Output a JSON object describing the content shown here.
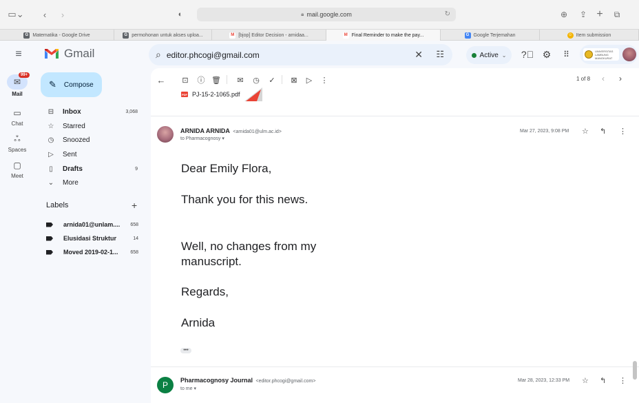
{
  "browser": {
    "url": "mail.google.com",
    "tabs": [
      {
        "label": "Matematika - Google Drive",
        "favicon_color": "#5f6368",
        "favicon": "G",
        "active": false
      },
      {
        "label": "permohonan untuk akses uploa...",
        "favicon_color": "#5f6368",
        "favicon": "G",
        "active": false
      },
      {
        "label": "[bjop] Editor Decision - arnidaa...",
        "favicon_color": "#ea4335",
        "favicon": "M",
        "active": false
      },
      {
        "label": "Final Reminder to make the pay...",
        "favicon_color": "#ea4335",
        "favicon": "M",
        "active": true
      },
      {
        "label": "Google Terjemahan",
        "favicon_color": "#4285f4",
        "favicon": "G",
        "active": false
      },
      {
        "label": "Item submission",
        "favicon_color": "#f4b400",
        "favicon": "☺",
        "active": false
      }
    ]
  },
  "header": {
    "app_name": "Gmail",
    "search_value": "editor.phcogi@gmail.com",
    "status_label": "Active",
    "status_color": "#188038",
    "university_text": "UNIVERSITAS LAMBUNG MANGKURAT"
  },
  "rail": {
    "items": [
      {
        "label": "Mail",
        "icon": "mail-icon",
        "badge": "99+",
        "active": true
      },
      {
        "label": "Chat",
        "icon": "chat-icon",
        "active": false
      },
      {
        "label": "Spaces",
        "icon": "spaces-icon",
        "active": false
      },
      {
        "label": "Meet",
        "icon": "meet-icon",
        "active": false
      }
    ]
  },
  "sidebar": {
    "compose_label": "Compose",
    "items": [
      {
        "label": "Inbox",
        "count": "3,068",
        "icon": "inbox-icon",
        "bold": true
      },
      {
        "label": "Starred",
        "count": "",
        "icon": "star-icon",
        "bold": false
      },
      {
        "label": "Snoozed",
        "count": "",
        "icon": "clock-icon",
        "bold": false
      },
      {
        "label": "Sent",
        "count": "",
        "icon": "send-icon",
        "bold": false
      },
      {
        "label": "Drafts",
        "count": "9",
        "icon": "draft-icon",
        "bold": true
      },
      {
        "label": "More",
        "count": "",
        "icon": "chevron-down-icon",
        "bold": false
      }
    ],
    "labels_header": "Labels",
    "labels": [
      {
        "label": "arnida01@unlam....",
        "count": "658"
      },
      {
        "label": "Elusidasi Struktur",
        "count": "14"
      },
      {
        "label": "Moved 2019-02-1...",
        "count": "658"
      }
    ]
  },
  "toolbar": {
    "pager": "1 of 8"
  },
  "thread": {
    "attachment_name": "PJ-15-2-1065.pdf",
    "messages": [
      {
        "sender_name": "ARNIDA ARNIDA",
        "sender_email": "<arnida01@ulm.ac.id>",
        "recipient": "to Pharmacognosy",
        "date": "Mar 27, 2023, 9:08 PM",
        "body": [
          "Dear Emily Flora,",
          "Thank you for this news.",
          "Well, no changes from my manuscript.",
          "Regards,",
          "Arnida"
        ],
        "ellipsis": "•••"
      },
      {
        "sender_name": "Pharmacognosy Journal",
        "sender_email": "<editor.phcogi@gmail.com>",
        "recipient": "to me",
        "date": "Mar 28, 2023, 12:33 PM",
        "avatar_letter": "P",
        "avatar_color": "#0b8043"
      }
    ]
  }
}
